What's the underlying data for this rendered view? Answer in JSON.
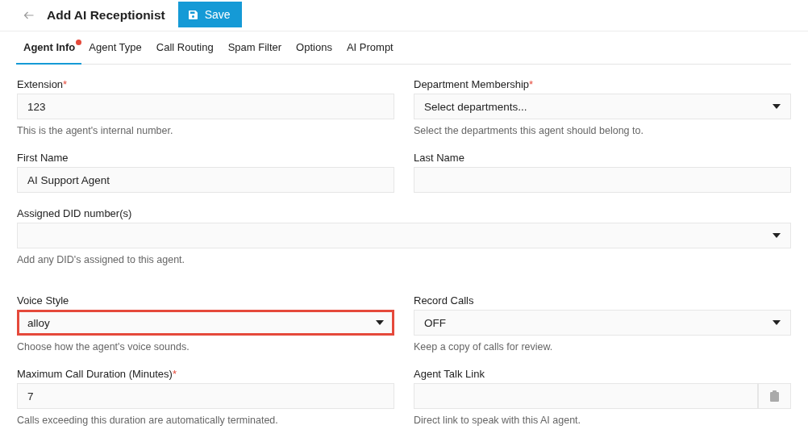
{
  "header": {
    "title": "Add AI Receptionist",
    "save_button": "Save"
  },
  "tabs": [
    {
      "label": "Agent Info",
      "selected": true,
      "alert": true
    },
    {
      "label": "Agent Type",
      "selected": false,
      "alert": false
    },
    {
      "label": "Call Routing",
      "selected": false,
      "alert": false
    },
    {
      "label": "Spam Filter",
      "selected": false,
      "alert": false
    },
    {
      "label": "Options",
      "selected": false,
      "alert": false
    },
    {
      "label": "AI Prompt",
      "selected": false,
      "alert": false
    }
  ],
  "sections": [
    {
      "rows": [
        [
          {
            "kind": "text",
            "label": "Extension",
            "required_mark": "*",
            "value": "123",
            "help": "This is the agent's internal number.",
            "highlighted": false
          },
          {
            "kind": "select",
            "label": "Department Membership",
            "required_mark": "*",
            "placeholder": "Select departments...",
            "help": "Select the departments this agent should belong to.",
            "highlighted": false
          }
        ],
        [
          {
            "kind": "text",
            "label": "First Name",
            "value": "AI Support Agent",
            "highlighted": false
          },
          {
            "kind": "text",
            "label": "Last Name",
            "highlighted": false
          }
        ],
        [
          {
            "kind": "select",
            "label": "Assigned DID number(s)",
            "help": "Add any DID's assigned to this agent.",
            "highlighted": false
          }
        ]
      ]
    },
    {
      "rows": [
        [
          {
            "kind": "select",
            "label": "Voice Style",
            "value": "alloy",
            "help": "Choose how the agent's voice sounds.",
            "highlighted": true
          },
          {
            "kind": "select",
            "label": "Record Calls",
            "value": "OFF",
            "help": "Keep a copy of calls for review.",
            "highlighted": false
          }
        ],
        [
          {
            "kind": "text",
            "label": "Maximum Call Duration (Minutes)",
            "required_mark": "*",
            "value": "7",
            "help": "Calls exceeding this duration are automatically terminated.",
            "highlighted": false
          },
          {
            "kind": "link",
            "label": "Agent Talk Link",
            "help": "Direct link to speak with this AI agent.",
            "highlighted": false
          }
        ]
      ]
    }
  ]
}
